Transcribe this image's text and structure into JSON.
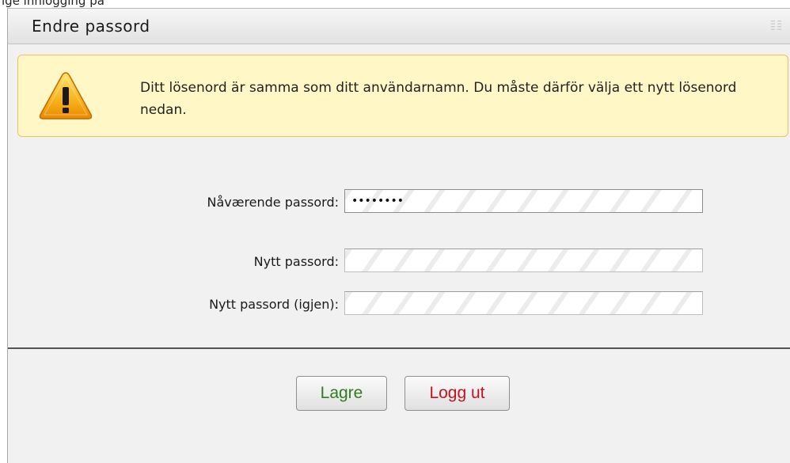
{
  "top_clipped_text": "ige innlogging på",
  "window": {
    "title": "Endre passord"
  },
  "warning": {
    "message": "Ditt lösenord är samma som ditt användarnamn. Du måste därför välja ett nytt lösenord nedan."
  },
  "form": {
    "current_password_label": "Nåværende passord:",
    "current_password_value": "••••••••",
    "new_password_label": "Nytt passord:",
    "new_password_value": "",
    "confirm_password_label": "Nytt passord (igjen):",
    "confirm_password_value": ""
  },
  "buttons": {
    "save_label": "Lagre",
    "logout_label": "Logg ut"
  },
  "colors": {
    "save_text": "#2e7d1e",
    "logout_text": "#c0141e",
    "warning_bg": "#fff7c6",
    "warning_border": "#f0c060"
  },
  "icons": {
    "warning": "warning-triangle-icon",
    "grip": "grip-icon"
  }
}
